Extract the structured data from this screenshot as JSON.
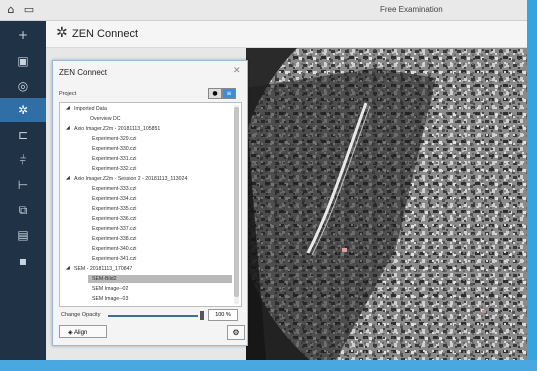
{
  "window": {
    "title": "Free Examination"
  },
  "app_header": {
    "title": "ZEN Connect"
  },
  "dialog": {
    "title": "ZEN Connect",
    "project_label": "Project",
    "change_opacity_label": "Change Opacity",
    "opacity_value": "100 %",
    "opacity_fraction": 1.0,
    "align_label": "Align"
  },
  "tree": [
    {
      "label": "Imported Data",
      "level": 0,
      "expanded": true
    },
    {
      "label": "Overview DC",
      "level": 1
    },
    {
      "label": "Axio Imager.Z2m - 20181113_105851",
      "level": 0,
      "expanded": true
    },
    {
      "label": "Experiment-329.czi",
      "level": 2
    },
    {
      "label": "Experiment-330.czi",
      "level": 2
    },
    {
      "label": "Experiment-331.czi",
      "level": 2
    },
    {
      "label": "Experiment-332.czi",
      "level": 2
    },
    {
      "label": "Axio Imager.Z2m - Session 2 - 20181113_113024",
      "level": 0,
      "expanded": true
    },
    {
      "label": "Experiment-333.czi",
      "level": 2
    },
    {
      "label": "Experiment-334.czi",
      "level": 2
    },
    {
      "label": "Experiment-335.czi",
      "level": 2
    },
    {
      "label": "Experiment-336.czi",
      "level": 2
    },
    {
      "label": "Experiment-337.czi",
      "level": 2
    },
    {
      "label": "Experiment-338.czi",
      "level": 2
    },
    {
      "label": "Experiment-340.czi",
      "level": 2
    },
    {
      "label": "Experiment-341.czi",
      "level": 2
    },
    {
      "label": "SEM - 20181113_170847",
      "level": 0,
      "expanded": true
    },
    {
      "label": "SEM-Bild2",
      "level": 2,
      "selected": true
    },
    {
      "label": "SEM Image--02",
      "level": 2
    },
    {
      "label": "SEM Image--03",
      "level": 2
    }
  ],
  "icons": {
    "home": "home-icon",
    "window": "window-icon",
    "header": "zen-connect-icon"
  },
  "colors": {
    "accent": "#2f6fa6",
    "sidebar": "#1f3246",
    "selection": "#b9b9b9"
  }
}
